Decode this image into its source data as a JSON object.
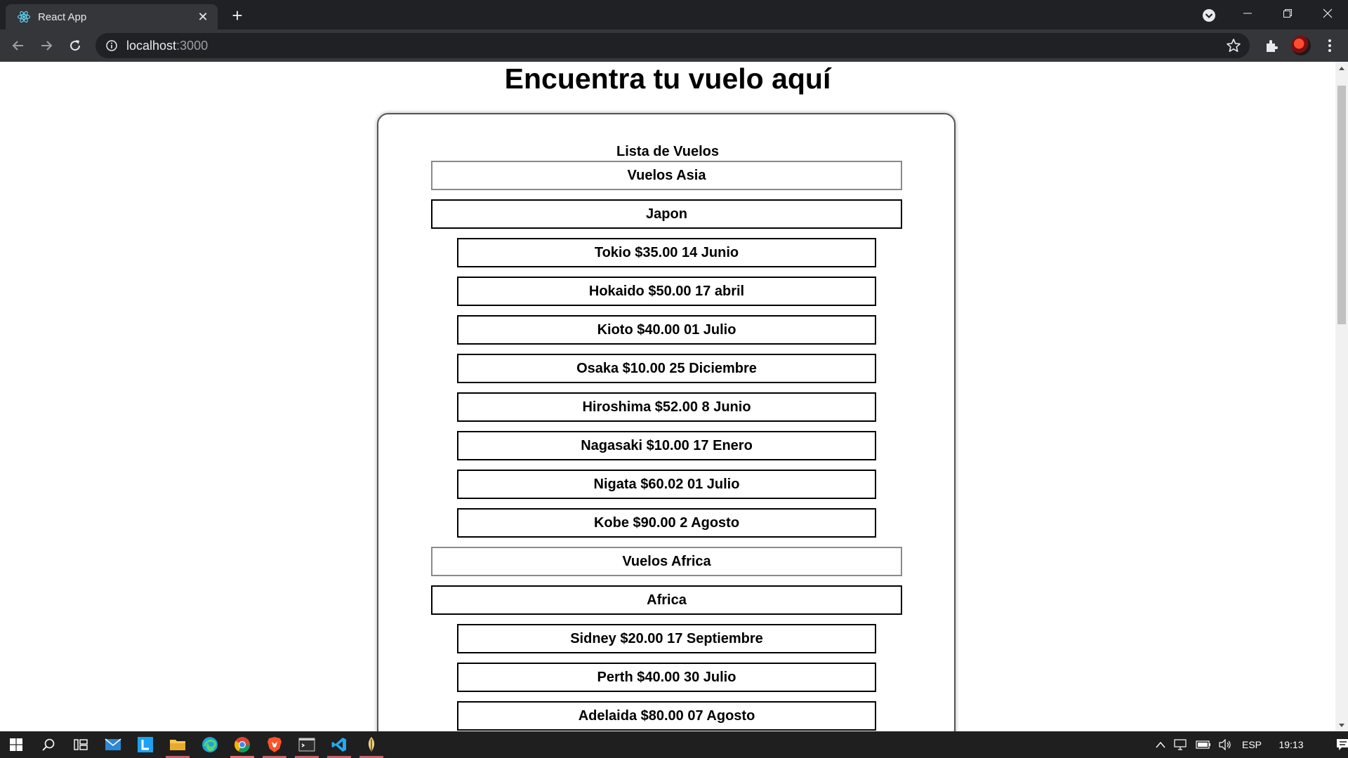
{
  "browser": {
    "tab_title": "React App",
    "tab_close_glyph": "✕",
    "new_tab_glyph": "+",
    "url_host": "localhost",
    "url_port": ":3000",
    "icons": [
      "react-favicon-icon",
      "tab-search-icon",
      "minimize-icon",
      "restore-icon",
      "close-icon",
      "back-icon",
      "forward-icon",
      "reload-icon",
      "site-info-icon",
      "bookmark-star-icon",
      "extensions-icon",
      "profile-avatar",
      "menu-icon"
    ]
  },
  "page": {
    "title": "Encuentra tu vuelo aquí",
    "list_heading": "Lista de Vuelos",
    "rows": [
      {
        "kind": "region",
        "label": "Vuelos Asia"
      },
      {
        "kind": "country",
        "label": "Japon"
      },
      {
        "kind": "flight",
        "label": "Tokio $35.00 14 Junio"
      },
      {
        "kind": "flight",
        "label": "Hokaido $50.00 17 abril"
      },
      {
        "kind": "flight",
        "label": "Kioto $40.00 01 Julio"
      },
      {
        "kind": "flight",
        "label": "Osaka $10.00 25 Diciembre"
      },
      {
        "kind": "flight",
        "label": "Hiroshima $52.00 8 Junio"
      },
      {
        "kind": "flight",
        "label": "Nagasaki $10.00 17 Enero"
      },
      {
        "kind": "flight",
        "label": "Nigata $60.02 01 Julio"
      },
      {
        "kind": "flight",
        "label": "Kobe $90.00 2 Agosto"
      },
      {
        "kind": "region",
        "label": "Vuelos Africa"
      },
      {
        "kind": "country",
        "label": "Africa"
      },
      {
        "kind": "flight",
        "label": "Sidney $20.00 17 Septiembre"
      },
      {
        "kind": "flight",
        "label": "Perth $40.00 30 Julio"
      },
      {
        "kind": "flight",
        "label": "Adelaida $80.00 07 Agosto"
      }
    ]
  },
  "taskbar": {
    "apps": [
      "windows-start-icon",
      "search-icon",
      "task-view-icon",
      "mail-icon",
      "l-app-icon",
      "file-explorer-icon",
      "edge-icon",
      "chrome-icon",
      "brave-icon",
      "terminal-icon",
      "vscode-icon",
      "mongodb-compass-icon"
    ],
    "language": "ESP",
    "time": "19:13"
  },
  "colors": {
    "titlebar": "#202124",
    "toolbar": "#35363a",
    "page_bg": "#ffffff",
    "taskbar": "#1f1f1f",
    "taskbar_indicator": "#e06c75"
  }
}
